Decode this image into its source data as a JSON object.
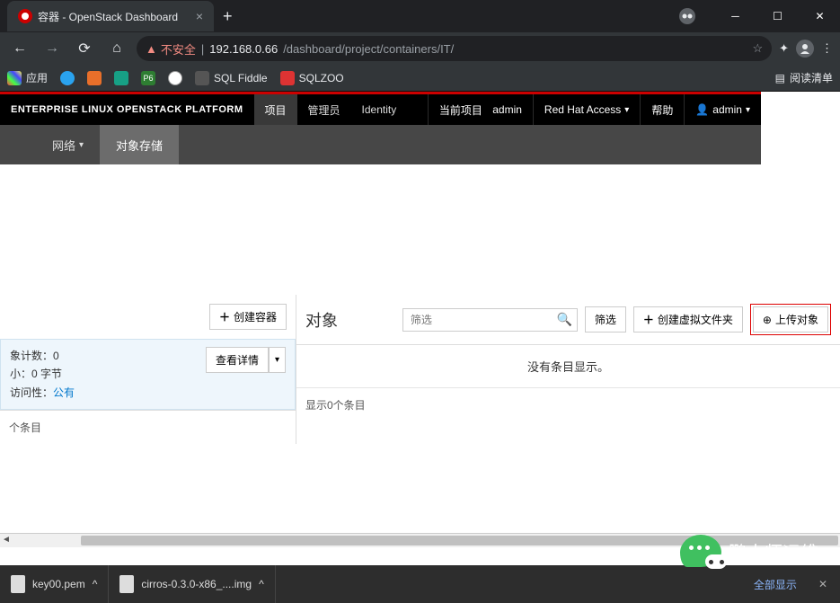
{
  "browser": {
    "tab_title": "容器 - OpenStack Dashboard",
    "url_warning": "不安全",
    "url_host": "192.168.0.66",
    "url_path": "/dashboard/project/containers/IT/",
    "apps_label": "应用",
    "bookmarks": {
      "sqlfiddle": "SQL Fiddle",
      "sqlzoo": "SQLZOO"
    },
    "reading_list": "阅读清单"
  },
  "os": {
    "brand": "ENTERPRISE LINUX OPENSTACK PLATFORM",
    "topnav": {
      "project": "项目",
      "admin": "管理员",
      "identity": "Identity"
    },
    "topright": {
      "current_project_label": "当前项目",
      "current_project_value": "admin",
      "redhat_access": "Red Hat Access",
      "help": "帮助",
      "user_label": "admin"
    },
    "subnav": {
      "network": "网络",
      "object_storage": "对象存储"
    }
  },
  "containers": {
    "create_container": "创建容器",
    "info": {
      "count_label": "象计数",
      "count_value": "0",
      "size_label": "小",
      "size_value": "0 字节",
      "access_label": "访问性",
      "access_value": "公有",
      "view_details": "查看详情"
    },
    "footer_left": "个条目"
  },
  "objects": {
    "title": "对象",
    "filter_placeholder": "筛选",
    "filter_btn": "筛选",
    "create_pseudo_folder": "创建虚拟文件夹",
    "upload_object": "上传对象",
    "empty_msg": "没有条目显示。",
    "footer": "显示0个条目"
  },
  "downloads": {
    "item1": "key00.pem",
    "item2": "cirros-0.3.0-x86_....img",
    "show_all": "全部显示"
  },
  "watermark": {
    "text": "鹏大师运维"
  }
}
